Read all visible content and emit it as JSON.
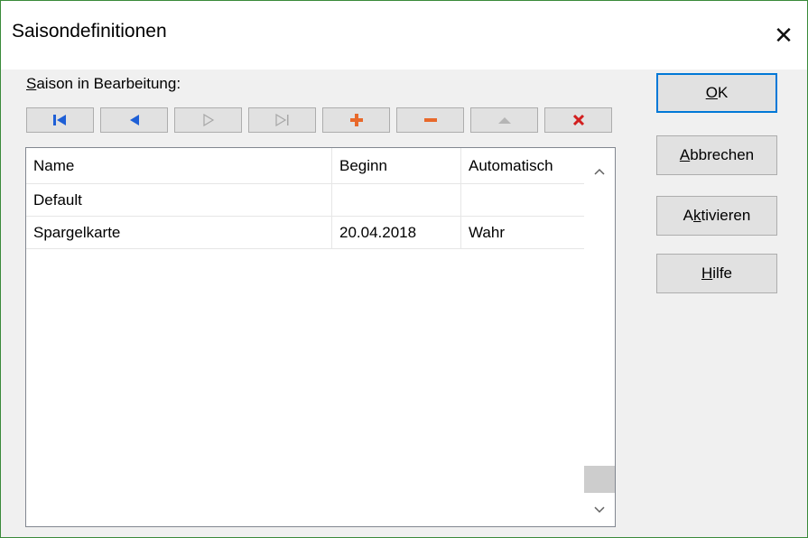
{
  "window": {
    "title": "Saisondefinitionen",
    "close_glyph": "✕"
  },
  "section": {
    "label_accel": "S",
    "label_rest": "aison in Bearbeitung:"
  },
  "toolbar": {
    "buttons": [
      {
        "icon": "first-record-icon",
        "color": "#1e5fd6"
      },
      {
        "icon": "previous-record-icon",
        "color": "#1e5fd6"
      },
      {
        "icon": "next-record-icon",
        "color": "#a7a7a7"
      },
      {
        "icon": "last-record-icon",
        "color": "#a7a7a7"
      },
      {
        "icon": "insert-record-icon",
        "color": "#e8692b"
      },
      {
        "icon": "delete-record-icon",
        "color": "#e8692b"
      },
      {
        "icon": "edit-record-icon",
        "color": "#b5b5b5"
      },
      {
        "icon": "cancel-edit-icon",
        "color": "#d21f1f"
      }
    ]
  },
  "grid": {
    "columns": [
      "Name",
      "Beginn",
      "Automatisch"
    ],
    "rows": [
      [
        "Default",
        "",
        ""
      ],
      [
        "Spargelkarte",
        "20.04.2018",
        "Wahr"
      ]
    ]
  },
  "buttons": {
    "ok": {
      "accel": "O",
      "rest": "K"
    },
    "cancel": {
      "accel": "A",
      "rest": "bbrechen"
    },
    "activate": {
      "pre": "A",
      "accel": "k",
      "rest": "tivieren"
    },
    "help": {
      "accel": "H",
      "rest": "ilfe"
    }
  },
  "colors": {
    "focus_border": "#0078d7",
    "window_border": "#3a8a3a"
  }
}
